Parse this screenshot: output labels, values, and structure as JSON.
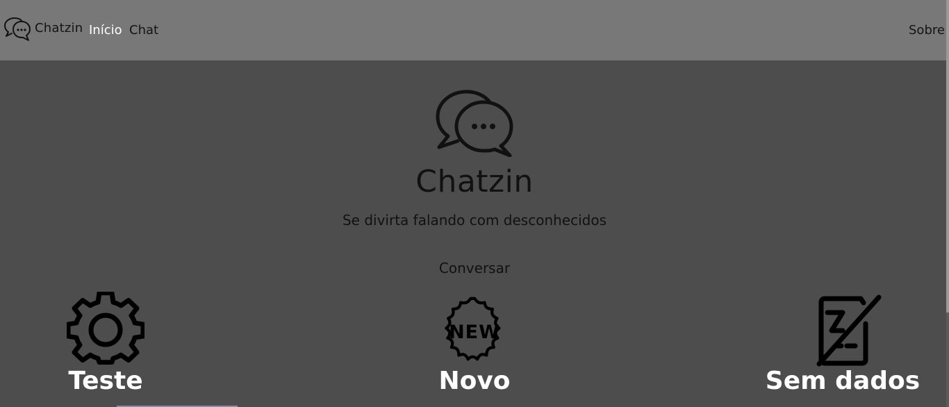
{
  "navbar": {
    "brand": "Chatzin",
    "links": [
      "Início",
      "Chat"
    ],
    "right_link": "Sobre",
    "active_link": "Início",
    "background": "#787878",
    "active_color": "#ffffff"
  },
  "hero": {
    "icon": "chat-bubbles-icon",
    "title": "Chatzin",
    "subtitle": "Se divirta falando com desconhecidos",
    "cta": "Conversar"
  },
  "features": [
    {
      "label": "Teste",
      "icon": "gear-icon"
    },
    {
      "label": "Novo",
      "icon": "new-badge-icon"
    },
    {
      "label": "Sem dados",
      "icon": "no-data-icon"
    }
  ],
  "colors": {
    "page_background": "#4d4d4d",
    "text_dark": "#111111",
    "text_light": "#ffffff"
  }
}
